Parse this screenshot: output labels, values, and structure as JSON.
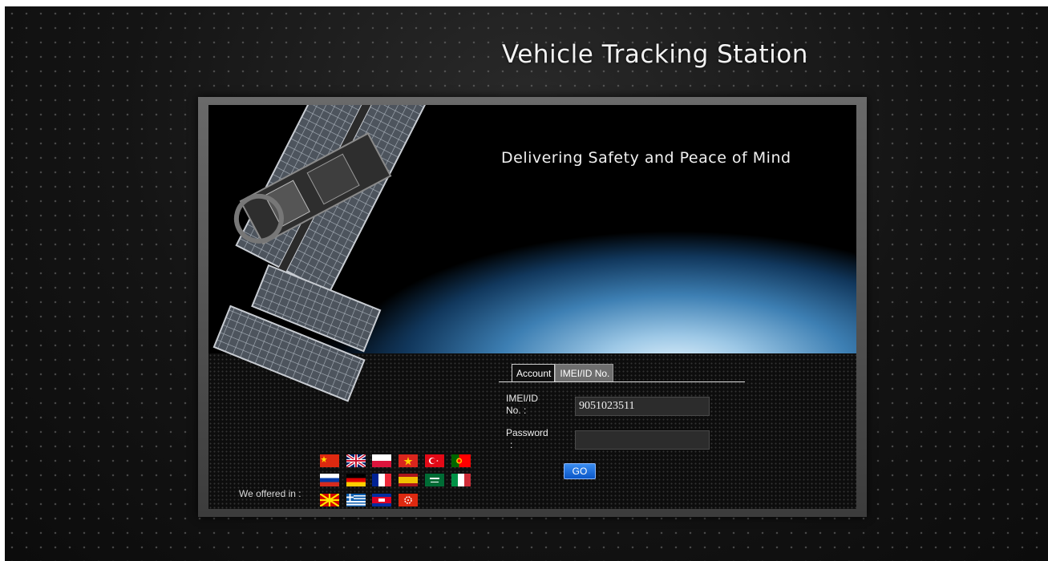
{
  "header": {
    "title": "Vehicle Tracking Station"
  },
  "banner": {
    "tagline": "Delivering Safety and Peace of Mind"
  },
  "login": {
    "tabs": [
      {
        "label": "Account",
        "active": true
      },
      {
        "label": "IMEI/ID No.",
        "active": false
      }
    ],
    "imei_label_line1": "IMEI/ID",
    "imei_label_line2": "No. :",
    "imei_value": "9051023511",
    "password_label_line1": "Password",
    "password_label_line2": ":",
    "password_value": "",
    "go_label": "GO"
  },
  "languages": {
    "label": "We offered in :",
    "flags": [
      "china",
      "uk",
      "poland",
      "vietnam",
      "turkey",
      "portugal",
      "russia",
      "germany",
      "france",
      "spain",
      "saudi-arabia",
      "italy",
      "macedonia",
      "greece",
      "cambodia",
      "hong-kong"
    ]
  },
  "colors": {
    "go_button": "#0a56c8",
    "accent_text": "#f0f0f0"
  }
}
